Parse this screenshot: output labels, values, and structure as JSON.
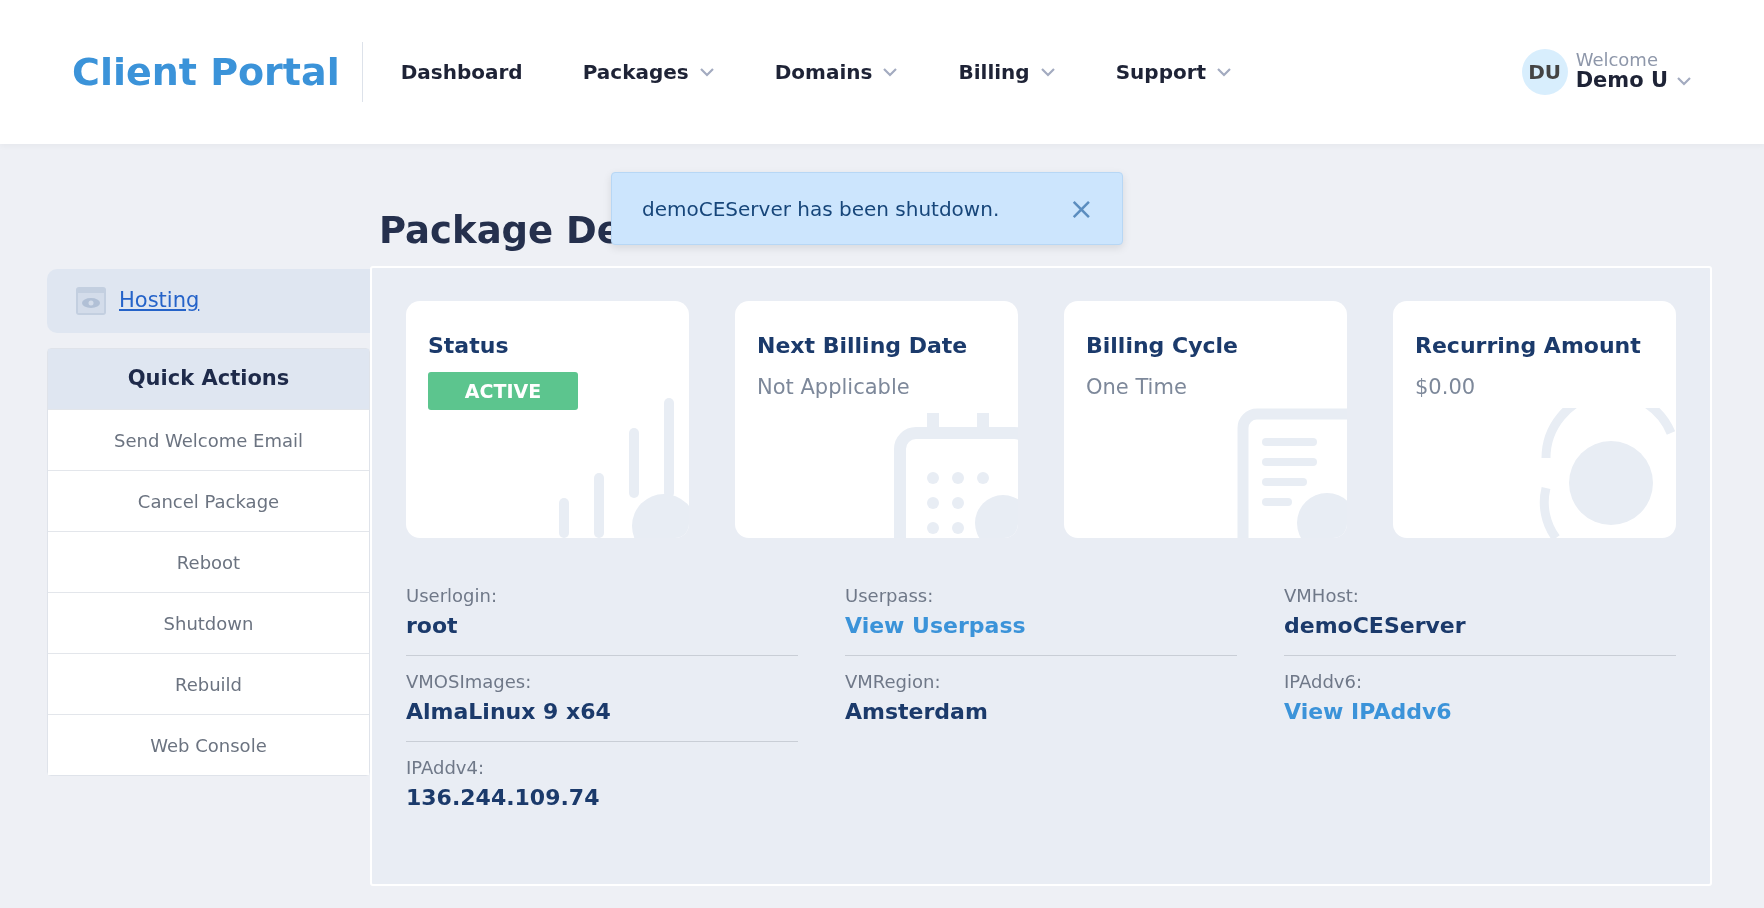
{
  "brand": "Client Portal",
  "nav": [
    {
      "label": "Dashboard",
      "dropdown": false
    },
    {
      "label": "Packages",
      "dropdown": true
    },
    {
      "label": "Domains",
      "dropdown": true
    },
    {
      "label": "Billing",
      "dropdown": true
    },
    {
      "label": "Support",
      "dropdown": true
    }
  ],
  "user": {
    "initials": "DU",
    "greeting": "Welcome",
    "name": "Demo U"
  },
  "toast": {
    "message": "demoCEServer has been shutdown.",
    "close": "×"
  },
  "title": "Package De",
  "sidebar": {
    "link": "Hosting",
    "quick_actions_title": "Quick Actions",
    "actions": [
      "Send Welcome Email",
      "Cancel Package",
      "Reboot",
      "Shutdown",
      "Rebuild",
      "Web Console"
    ]
  },
  "cards": [
    {
      "kind": "status",
      "title": "Status",
      "value": "ACTIVE"
    },
    {
      "kind": "calendar",
      "title": "Next Billing Date",
      "value": "Not Applicable"
    },
    {
      "kind": "invoice",
      "title": "Billing Cycle",
      "value": "One Time"
    },
    {
      "kind": "money",
      "title": "Recurring Amount",
      "value": "$0.00"
    }
  ],
  "fields": [
    [
      {
        "label": "Userlogin:",
        "value": "root",
        "kind": "text"
      },
      {
        "label": "VMOSImages:",
        "value": "AlmaLinux 9 x64",
        "kind": "text"
      },
      {
        "label": "IPAddv4:",
        "value": "136.244.109.74",
        "kind": "text"
      }
    ],
    [
      {
        "label": "Userpass:",
        "value": "View Userpass",
        "kind": "link"
      },
      {
        "label": "VMRegion:",
        "value": "Amsterdam",
        "kind": "text"
      }
    ],
    [
      {
        "label": "VMHost:",
        "value": "demoCEServer",
        "kind": "text"
      },
      {
        "label": "IPAddv6:",
        "value": "View IPAddv6",
        "kind": "link"
      }
    ]
  ]
}
